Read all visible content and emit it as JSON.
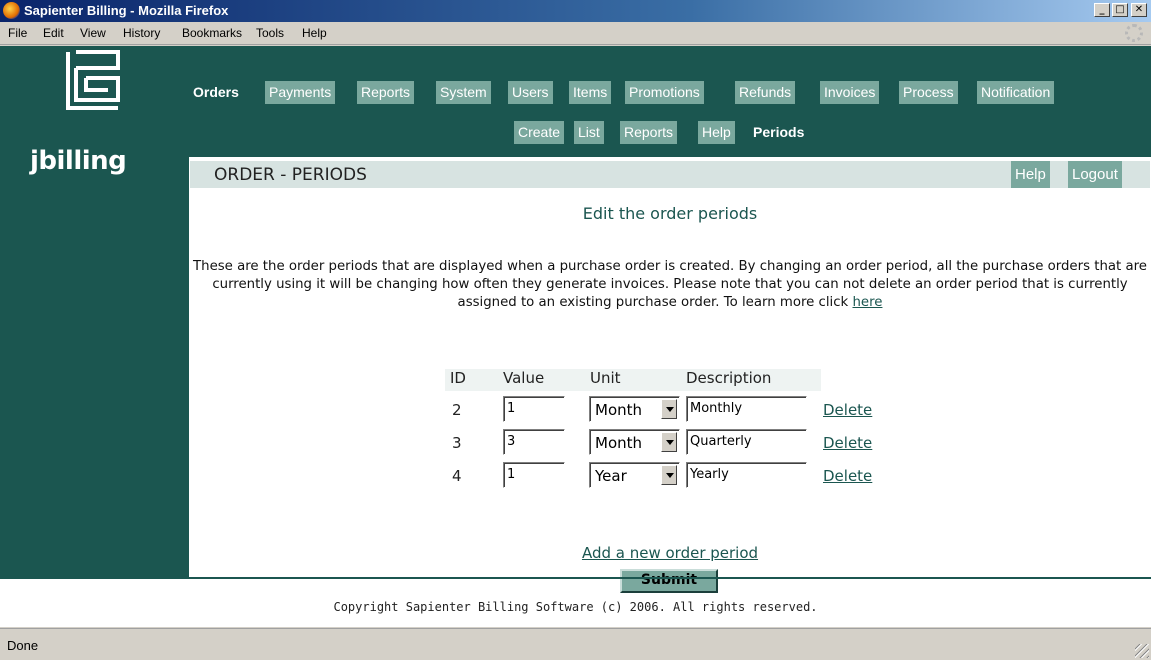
{
  "window": {
    "title": "Sapienter Billing - Mozilla Firefox",
    "buttons": [
      "_",
      "□",
      "✕"
    ]
  },
  "menu": [
    "File",
    "Edit",
    "View",
    "History",
    "Bookmarks",
    "Tools",
    "Help"
  ],
  "logo": {
    "text": "jbilling"
  },
  "nav": {
    "main_tabs": [
      "Orders",
      "Payments",
      "Reports",
      "System",
      "Users",
      "Items",
      "Promotions",
      "Refunds",
      "Invoices",
      "Process",
      "Notification"
    ],
    "sub_tabs": [
      "Create",
      "List",
      "Reports",
      "Help",
      "Periods"
    ]
  },
  "header": {
    "title": "ORDER - PERIODS",
    "help": "Help",
    "logout": "Logout"
  },
  "main": {
    "subtitle": "Edit the order periods",
    "intro_text": "These are the order periods that are displayed when a purchase order is created. By changing an order period, all the purchase orders that are currently using it will be changing how often they generate invoices. Please note that you can not delete an order period that is currently assigned to an existing purchase order. To learn more click",
    "intro_link": "here",
    "columns": [
      "ID",
      "Value",
      "Unit",
      "Description"
    ],
    "rows": [
      {
        "id": "2",
        "value": "1",
        "unit": "Month",
        "description": "Monthly",
        "action": "Delete"
      },
      {
        "id": "3",
        "value": "3",
        "unit": "Month",
        "description": "Quarterly",
        "action": "Delete"
      },
      {
        "id": "4",
        "value": "1",
        "unit": "Year",
        "description": "Yearly",
        "action": "Delete"
      }
    ],
    "add_link": "Add a new order period",
    "submit": "Submit"
  },
  "footer": "Copyright Sapienter Billing Software (c) 2006. All rights reserved.",
  "status": "Done",
  "colors": {
    "brand": "#1b5650",
    "tab": "#7aa89e",
    "header_bar": "#d7e3e1"
  }
}
